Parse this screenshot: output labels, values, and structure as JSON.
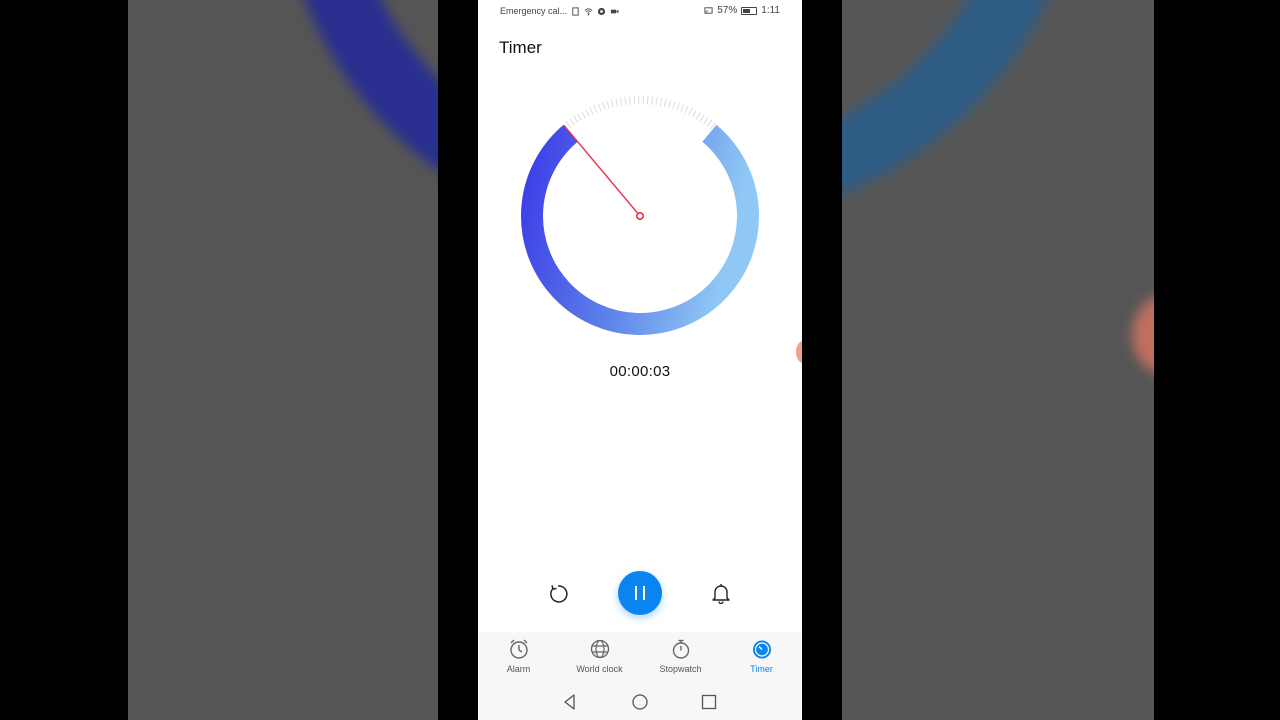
{
  "status_bar": {
    "carrier": "Emergency cal...",
    "battery": "57%",
    "time": "1:11"
  },
  "header": {
    "title": "Timer"
  },
  "timer": {
    "remaining": "00:00:03",
    "progress_fraction": 0.89
  },
  "controls": {
    "reset_icon": "reset-icon",
    "pause_icon": "pause-icon",
    "ringtone_icon": "bell-icon"
  },
  "tabs": [
    {
      "label": "Alarm",
      "icon": "alarm-icon"
    },
    {
      "label": "World clock",
      "icon": "globe-icon"
    },
    {
      "label": "Stopwatch",
      "icon": "stopwatch-icon"
    },
    {
      "label": "Timer",
      "icon": "timer-icon",
      "active": true
    }
  ],
  "colors": {
    "accent": "#0a84f0",
    "ring_start": "#3d3de8",
    "ring_end": "#8fc8f5",
    "needle": "#e8334a"
  }
}
